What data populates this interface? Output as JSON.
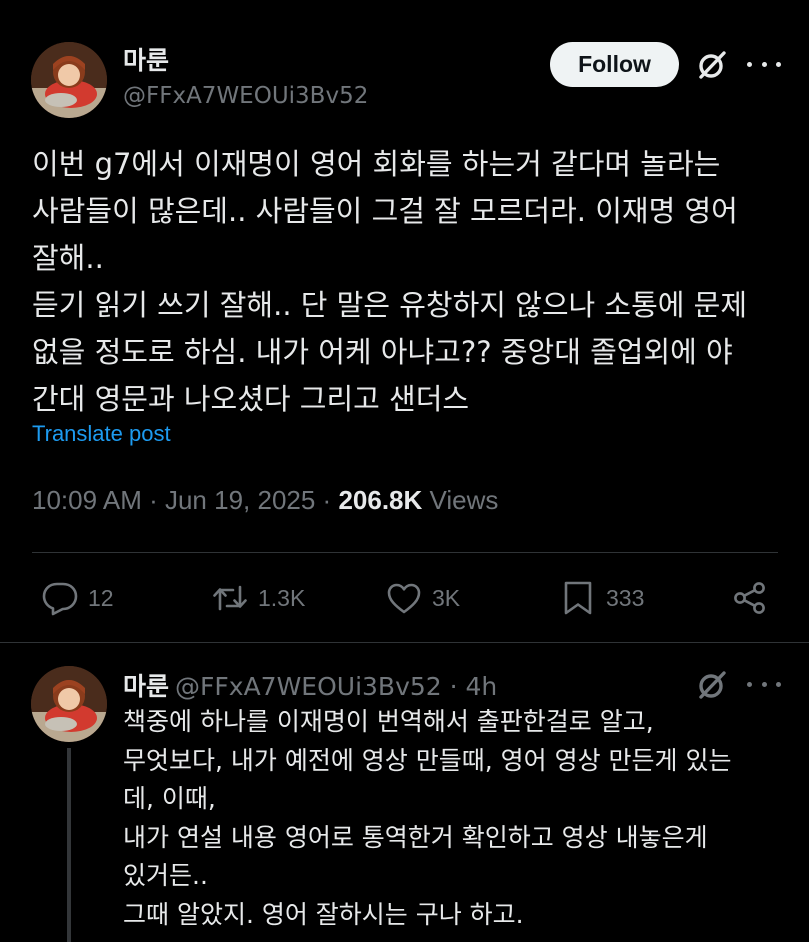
{
  "post": {
    "display_name": "마룬",
    "handle": "@FFxA7WEOUi3Bv52",
    "follow_label": "Follow",
    "text_lines": [
      "이번 g7에서 이재명이 영어 회화를 하는거 같다며 놀라는",
      "사람들이 많은데.. 사람들이 그걸 잘 모르더라. 이재명 영어",
      "잘해..",
      "듣기 읽기 쓰기 잘해.. 단 말은 유창하지 않으나 소통에 문제",
      "없을 정도로 하심. 내가 어케 아냐고?? 중앙대 졸업외에 야",
      "간대 영문과 나오셨다 그리고 샌더스"
    ],
    "translate_label": "Translate post",
    "time": "10:09 AM",
    "separator": " · ",
    "date": "Jun 19, 2025",
    "views_count": "206.8K",
    "views_label": "Views"
  },
  "actions": {
    "replies": "12",
    "reposts": "1.3K",
    "likes": "3K",
    "bookmarks": "333"
  },
  "reply": {
    "display_name": "마룬",
    "handle": "@FFxA7WEOUi3Bv52",
    "age": "4h",
    "meta": "@FFxA7WEOUi3Bv52 · 4h",
    "text_lines": [
      "책중에 하나를 이재명이 번역해서 출판한걸로 알고,",
      "무엇보다, 내가 예전에 영상 만들때, 영어 영상 만든게 있는",
      "데, 이때,",
      "내가 연설 내용 영어로 통역한거 확인하고 영상 내놓은게",
      "있거든..",
      "그때 알았지. 영어 잘하시는 구나 하고."
    ]
  },
  "icons": {
    "grok": "grok-slash-circle-icon",
    "more": "more-horizontal-icon",
    "reply": "reply-bubble-icon",
    "repost": "repost-icon",
    "like": "heart-icon",
    "bookmark": "bookmark-icon",
    "share": "share-icon"
  },
  "colors": {
    "background": "#000000",
    "text": "#e7e9ea",
    "muted": "#71767b",
    "link": "#1d9bf0",
    "divider": "#2f3336",
    "follow_bg": "#eff3f4"
  }
}
